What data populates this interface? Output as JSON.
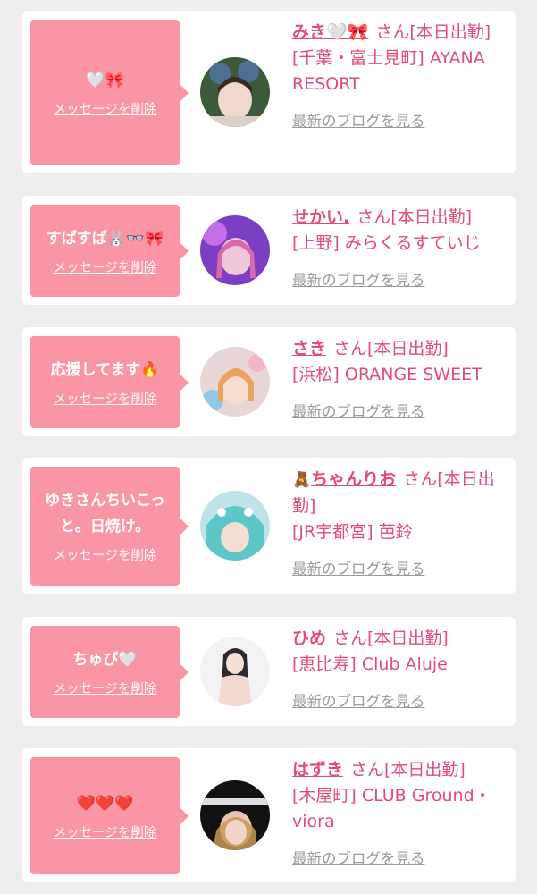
{
  "cards": [
    {
      "message": "🤍🎀",
      "delete_label": "メッセージを削除",
      "name": "みき🤍🎀",
      "name_suffix": "さん[本日出勤]",
      "location": "[千葉・富士見町] AYANA RESORT",
      "blog_link": "最新のブログを見る"
    },
    {
      "message": "すぱすぱ🐰👓🎀",
      "delete_label": "メッセージを削除",
      "name": "せかい.",
      "name_suffix": "さん[本日出勤]",
      "location": "[上野] みらくるすていじ",
      "blog_link": "最新のブログを見る"
    },
    {
      "message": "応援してます🔥",
      "delete_label": "メッセージを削除",
      "name": "さき",
      "name_suffix": "さん[本日出勤]",
      "location": "[浜松] ORANGE SWEET",
      "blog_link": "最新のブログを見る"
    },
    {
      "message": "ゆきさんちいこっと。日焼け。",
      "delete_label": "メッセージを削除",
      "name_icon": "🧸",
      "name": "ちゃんりお",
      "name_suffix": "さん[本日出勤]",
      "location": "[JR宇都宮] 芭鈴",
      "blog_link": "最新のブログを見る"
    },
    {
      "message": "ちゅぴ🤍",
      "delete_label": "メッセージを削除",
      "name": "ひめ",
      "name_suffix": "さん[本日出勤]",
      "location": "[恵比寿] Club Aluje",
      "blog_link": "最新のブログを見る"
    },
    {
      "message": "❤️❤️❤️",
      "delete_label": "メッセージを削除",
      "name": "はずき",
      "name_suffix": "さん[本日出勤]",
      "location": "[木屋町] CLUB Ground・viora",
      "blog_link": "最新のブログを見る"
    }
  ]
}
